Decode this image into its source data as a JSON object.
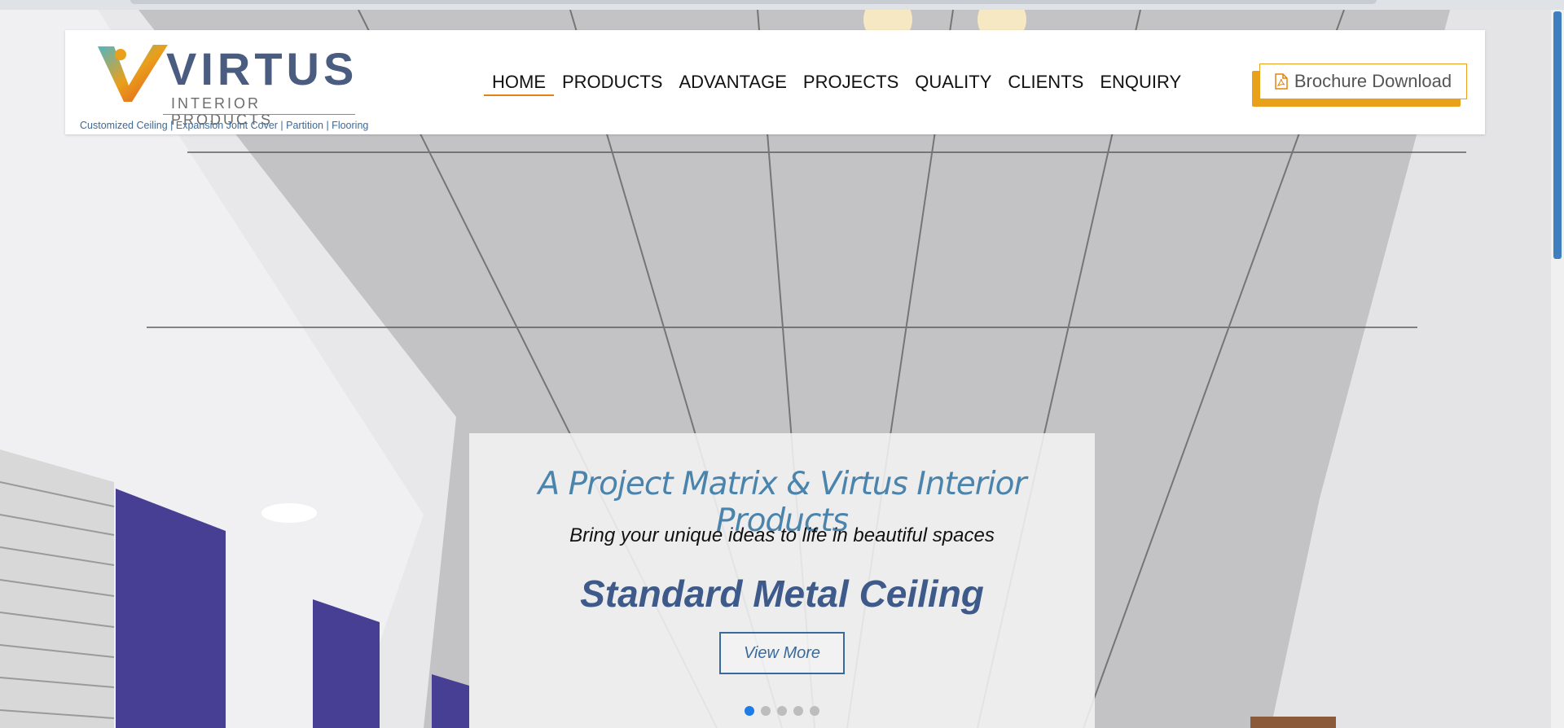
{
  "logo": {
    "brand": "VIRTUS",
    "subtitle": "INTERIOR PRODUCTS",
    "tagline": "Customized Ceiling | Expansion Joint Cover | Partition | Flooring"
  },
  "nav": {
    "items": [
      {
        "label": "HOME",
        "active": true
      },
      {
        "label": "PRODUCTS"
      },
      {
        "label": "ADVANTAGE"
      },
      {
        "label": "PROJECTS"
      },
      {
        "label": "QUALITY"
      },
      {
        "label": "CLIENTS"
      },
      {
        "label": "ENQUIRY"
      }
    ]
  },
  "brochure": {
    "label": "Brochure Download",
    "icon": "pdf-file-icon"
  },
  "slide": {
    "kicker": "A Project Matrix & Virtus Interior Products",
    "subtitle": "Bring your unique ideas to life in beautiful spaces",
    "title": "Standard Metal Ceiling",
    "button_label": "View More",
    "dots_count": 5,
    "active_dot": 1
  },
  "colors": {
    "accent_orange": "#e9a01b",
    "brand_blue": "#3e5a8a",
    "link_blue": "#4a84ad",
    "active_dot": "#1e7ce6"
  }
}
